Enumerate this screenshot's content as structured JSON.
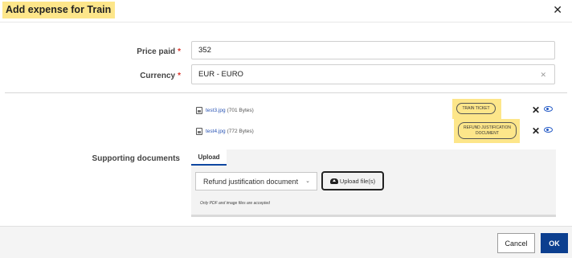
{
  "dialog": {
    "title": "Add expense for Train",
    "close_glyph": "✕"
  },
  "form": {
    "price_label": "Price paid",
    "price_value": "352",
    "currency_label": "Currency",
    "currency_value": "EUR - EURO",
    "currency_clear_glyph": "✕",
    "required_marker": "*"
  },
  "documents": {
    "label": "Supporting documents",
    "files": [
      {
        "name": "test3.jpg",
        "size": "(701 Bytes)",
        "tag": "TRAIN TICKET"
      },
      {
        "name": "test4.jpg",
        "size": "(772 Bytes)",
        "tag_line1": "REFUND JUSTIFICATION",
        "tag_line2": "DOCUMENT"
      }
    ],
    "remove_glyph": "✕"
  },
  "upload": {
    "tab_label": "Upload",
    "document_type_value": "Refund justification document",
    "chevron_glyph": "⌄",
    "upload_button_label": "Upload file(s)",
    "note": "Only PDF and image files are accepted"
  },
  "footer": {
    "cancel_label": "Cancel",
    "ok_label": "OK"
  },
  "colors": {
    "highlight": "#fde68a",
    "primary": "#0c3f8f",
    "link": "#2a55b5",
    "required": "#d9342b"
  }
}
